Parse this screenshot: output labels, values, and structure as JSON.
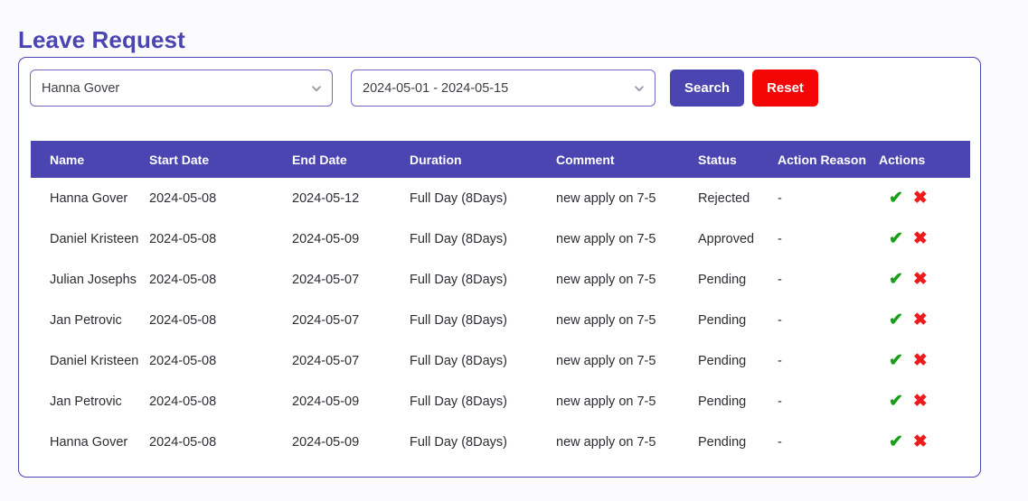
{
  "page_title": "Leave Request",
  "colors": {
    "brand_purple": "#4a45b1",
    "reset_red": "#f50606",
    "status_rejected": "#ef2b2b",
    "status_approved": "#3aa63a",
    "icon_approve_green": "#17a017",
    "icon_reject_red": "#ec1c1c",
    "page_background": "#fbfbfd"
  },
  "filters": {
    "employee_select": {
      "value": "Hanna Gover",
      "icon": "chevron-down-icon"
    },
    "date_range_select": {
      "value": "2024-05-01 - 2024-05-15",
      "icon": "chevron-down-icon"
    },
    "search_button": "Search",
    "reset_button": "Reset"
  },
  "table": {
    "columns": [
      "Name",
      "Start Date",
      "End Date",
      "Duration",
      "Comment",
      "Status",
      "Action Reason",
      "Actions"
    ],
    "action_icons": {
      "approve": "✔",
      "reject": "✖"
    },
    "rows": [
      {
        "name": "Hanna Gover",
        "start_date": "2024-05-08",
        "end_date": "2024-05-12",
        "duration": "Full Day (8Days)",
        "comment": "new apply on 7-5",
        "status": "Rejected",
        "status_kind": "rejected",
        "action_reason": "-"
      },
      {
        "name": "Daniel Kristeen",
        "start_date": "2024-05-08",
        "end_date": "2024-05-09",
        "duration": "Full Day (8Days)",
        "comment": "new apply on 7-5",
        "status": "Approved",
        "status_kind": "approved",
        "action_reason": "-"
      },
      {
        "name": "Julian Josephs",
        "start_date": "2024-05-08",
        "end_date": "2024-05-07",
        "duration": "Full Day (8Days)",
        "comment": "new apply on 7-5",
        "status": "Pending",
        "status_kind": "pending",
        "action_reason": "-"
      },
      {
        "name": "Jan Petrovic",
        "start_date": "2024-05-08",
        "end_date": "2024-05-07",
        "duration": "Full Day (8Days)",
        "comment": "new apply on 7-5",
        "status": "Pending",
        "status_kind": "pending",
        "action_reason": "-"
      },
      {
        "name": "Daniel Kristeen",
        "start_date": "2024-05-08",
        "end_date": "2024-05-07",
        "duration": "Full Day (8Days)",
        "comment": "new apply on 7-5",
        "status": "Pending",
        "status_kind": "pending",
        "action_reason": "-"
      },
      {
        "name": "Jan Petrovic",
        "start_date": "2024-05-08",
        "end_date": "2024-05-09",
        "duration": "Full Day (8Days)",
        "comment": "new apply on 7-5",
        "status": "Pending",
        "status_kind": "pending",
        "action_reason": "-"
      },
      {
        "name": "Hanna Gover",
        "start_date": "2024-05-08",
        "end_date": "2024-05-09",
        "duration": "Full Day (8Days)",
        "comment": "new apply on 7-5",
        "status": "Pending",
        "status_kind": "pending",
        "action_reason": "-"
      }
    ]
  }
}
